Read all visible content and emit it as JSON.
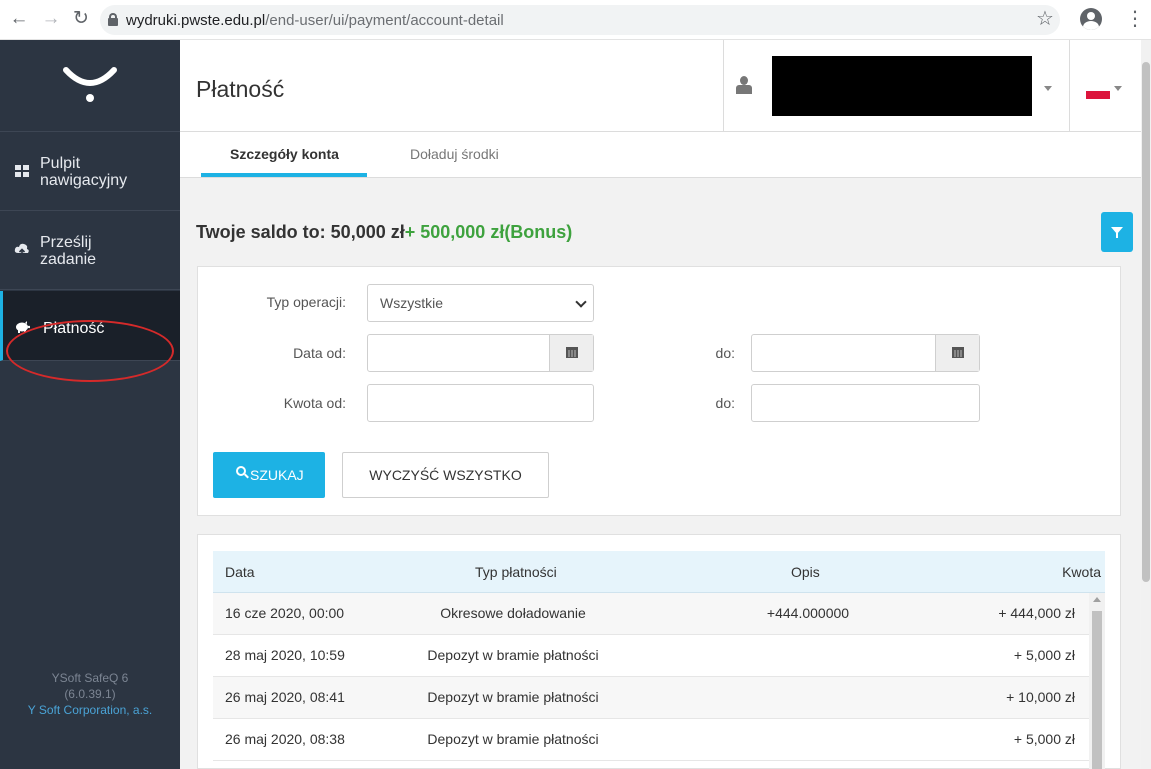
{
  "browser": {
    "url_host": "wydruki.pwste.edu.pl",
    "url_path": "/end-user/ui/payment/account-detail"
  },
  "sidebar": {
    "items": [
      {
        "label_line1": "Pulpit",
        "label_line2": "nawigacyjny",
        "icon": "dashboard-icon"
      },
      {
        "label_line1": "Prześlij",
        "label_line2": "zadanie",
        "icon": "cloud-upload-icon"
      },
      {
        "label": "Płatność",
        "icon": "piggy-bank-icon",
        "active": true
      }
    ],
    "footer": {
      "product": "YSoft SafeQ 6",
      "version": "(6.0.39.1)",
      "company": "Y Soft Corporation, a.s."
    }
  },
  "header": {
    "title": "Płatność"
  },
  "tabs": [
    {
      "label": "Szczegóły konta",
      "active": true
    },
    {
      "label": "Doładuj środki",
      "active": false
    }
  ],
  "balance": {
    "prefix": "Twoje saldo to: 50,000 zł",
    "bonus": "+ 500,000 zł(Bonus)"
  },
  "filters": {
    "type_label": "Typ operacji:",
    "type_value": "Wszystkie",
    "date_from_label": "Data od:",
    "date_to_label": "do:",
    "amount_from_label": "Kwota od:",
    "amount_to_label": "do:",
    "search_button": "SZUKAJ",
    "clear_button": "WYCZYŚĆ WSZYSTKO"
  },
  "table": {
    "headers": [
      "Data",
      "Typ płatności",
      "Opis",
      "Kwota"
    ],
    "rows": [
      {
        "date": "16 cze 2020, 00:00",
        "type": "Okresowe doładowanie",
        "desc": "+444.000000",
        "amount": "+ 444,000 zł"
      },
      {
        "date": "28 maj 2020, 10:59",
        "type": "Depozyt w bramie płatności",
        "desc": "",
        "amount": "+ 5,000 zł"
      },
      {
        "date": "26 maj 2020, 08:41",
        "type": "Depozyt w bramie płatności",
        "desc": "",
        "amount": "+ 10,000 zł"
      },
      {
        "date": "26 maj 2020, 08:38",
        "type": "Depozyt w bramie płatności",
        "desc": "",
        "amount": "+ 5,000 zł"
      }
    ]
  },
  "colors": {
    "accent": "#1db2e4",
    "sidebar_bg": "#2c3542",
    "bonus_green": "#3ea23e",
    "highlight_red": "#d52a2a"
  }
}
